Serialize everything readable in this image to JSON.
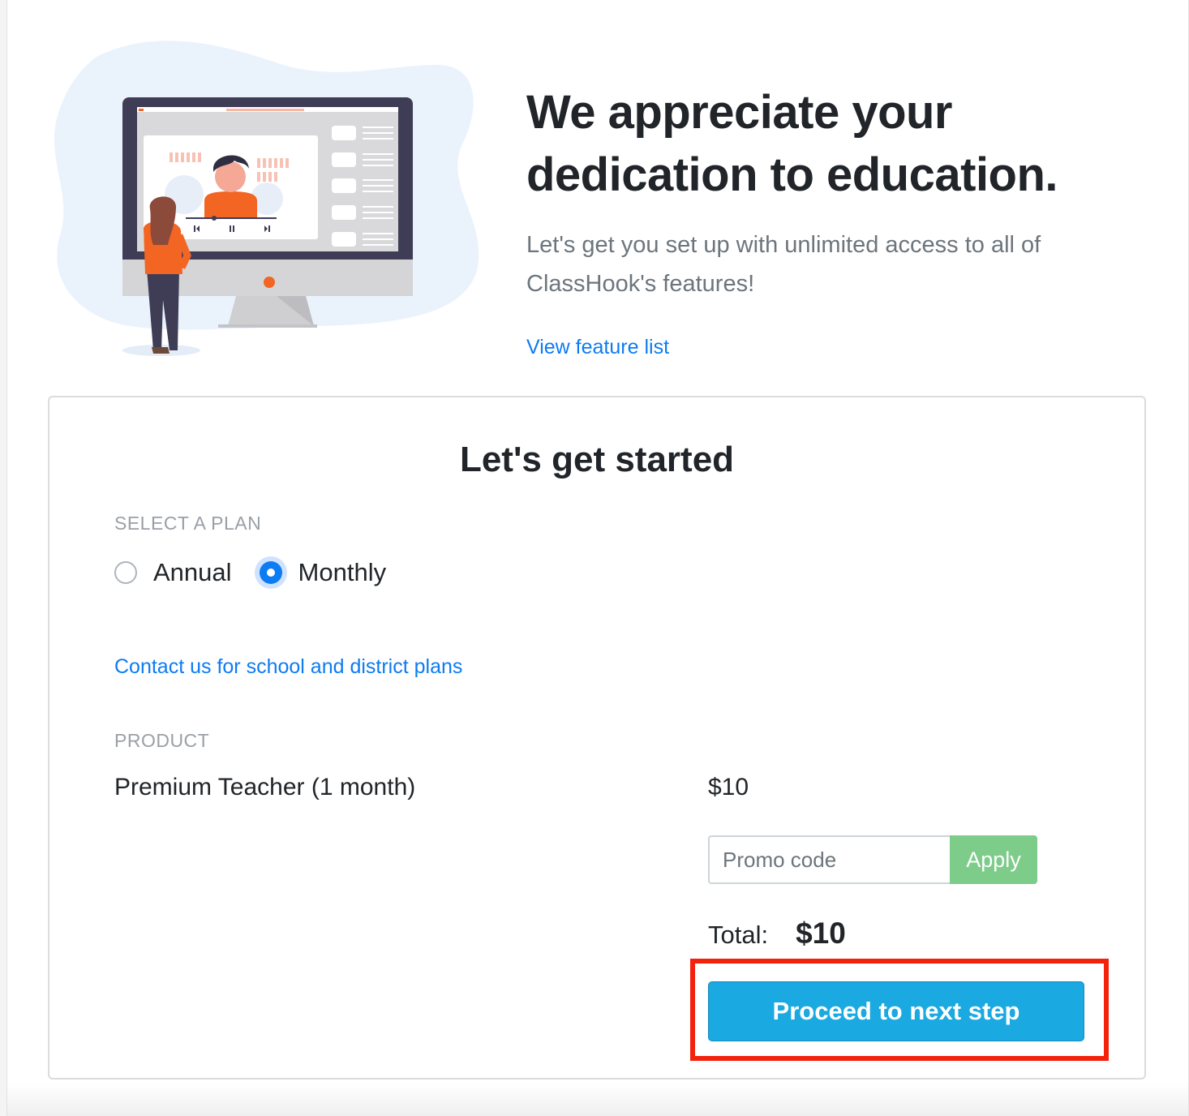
{
  "hero": {
    "title_line1": "We appreciate your",
    "title_line2": "dedication to education.",
    "subtitle_line1": "Let's get you set up with unlimited access to all of",
    "subtitle_line2": "ClassHook's features!",
    "feature_link": "View feature list"
  },
  "card": {
    "title": "Let's get started",
    "plan_label": "SELECT A PLAN",
    "plans": [
      {
        "label": "Annual",
        "selected": false
      },
      {
        "label": "Monthly",
        "selected": true
      }
    ],
    "contact_link": "Contact us for school and district plans",
    "product_label": "PRODUCT",
    "product_name": "Premium Teacher (1 month)",
    "product_price": "$10",
    "promo_placeholder": "Promo code",
    "apply_label": "Apply",
    "total_label": "Total:",
    "total_value": "$10",
    "proceed_label": "Proceed to next step"
  },
  "colors": {
    "link": "#0d7bf2",
    "apply": "#7dcc8a",
    "proceed": "#1ba9e1",
    "highlight": "#f2220d",
    "accent_orange": "#f26522"
  }
}
